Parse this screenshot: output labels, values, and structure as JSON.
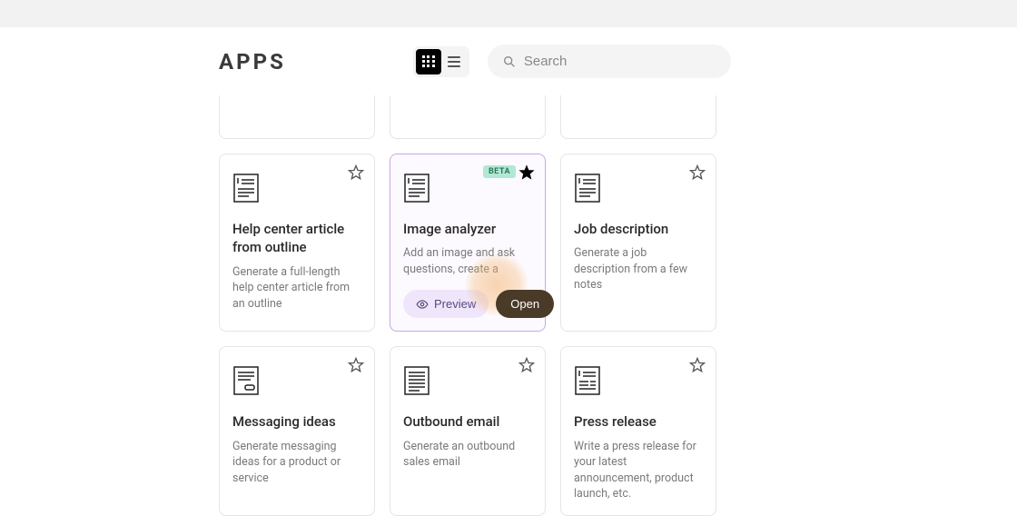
{
  "header": {
    "title": "APPS"
  },
  "search": {
    "placeholder": "Search"
  },
  "badges": {
    "beta": "BETA"
  },
  "actions": {
    "preview": "Preview",
    "open": "Open"
  },
  "cards": {
    "helpCenter": {
      "title": "Help center article from outline",
      "desc": "Generate a full-length help center article from an outline"
    },
    "imageAnalyzer": {
      "title": "Image analyzer",
      "desc": "Add an image and ask questions, create a"
    },
    "jobDescription": {
      "title": "Job description",
      "desc": "Generate a job description from a few notes"
    },
    "messagingIdeas": {
      "title": "Messaging ideas",
      "desc": "Generate messaging ideas for a product or service"
    },
    "outboundEmail": {
      "title": "Outbound email",
      "desc": "Generate an outbound sales email"
    },
    "pressRelease": {
      "title": "Press release",
      "desc": "Write a press release for your latest announcement, product launch, etc."
    }
  }
}
